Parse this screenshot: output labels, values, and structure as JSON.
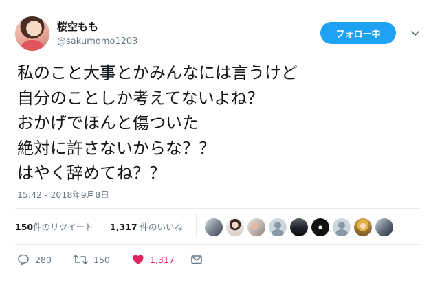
{
  "user": {
    "display_name": "桜空もも",
    "handle": "@sakumomo1203"
  },
  "header": {
    "follow_label": "フォロー中"
  },
  "tweet": {
    "lines": [
      "私のこと大事とかみんなには言うけど",
      "自分のことしか考えてないよね？",
      "おかげでほんと傷ついた",
      "絶対に許さないからな？？",
      "はやく辞めてね？？"
    ],
    "timestamp": "15:42 - 2018年9月8日"
  },
  "stats": {
    "retweets_count": "150",
    "retweets_label": "件のリツイート",
    "likes_count": "1,317",
    "likes_label": " 件のいいね"
  },
  "actions": {
    "replies": "280",
    "retweets": "150",
    "likes": "1,317"
  },
  "colors": {
    "accent": "#1da1f2",
    "like": "#e0245e",
    "secondary_text": "#657786"
  }
}
